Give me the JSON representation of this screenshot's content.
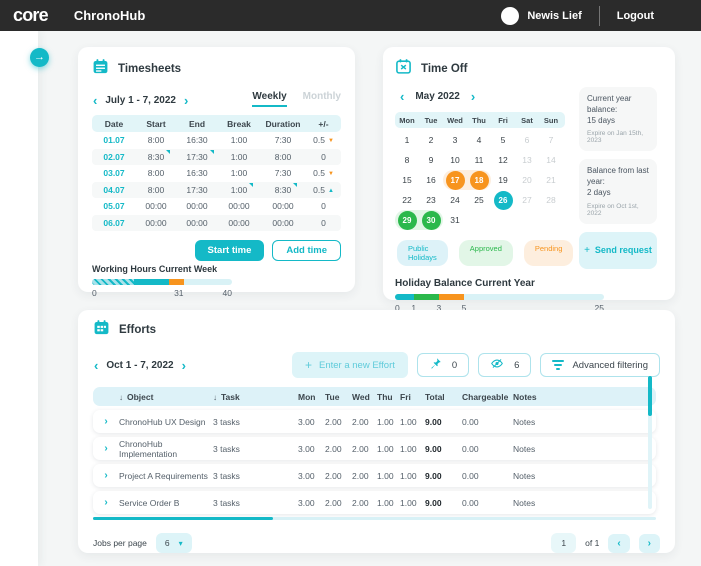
{
  "colors": {
    "accent": "#14b9c7",
    "accent_light_bg": "#ddf4f8",
    "table_header_bg": "#e2f5f8",
    "orange": "#f7941e",
    "orange_light_bg": "#fdeede",
    "green": "#2bb84c",
    "green_light_bg": "#e2f6e7",
    "topbar_bg": "#2b2b2b",
    "muted_text": "#c8cdd0"
  },
  "icons": [
    "arrow-right-icon",
    "home-icon",
    "calendar-icon",
    "wrench-icon",
    "check-circle-icon",
    "trend-icon",
    "chevron-left-icon",
    "chevron-right-icon",
    "chevron-down-icon",
    "timesheets-calendar-icon",
    "timeoff-calendar-icon",
    "efforts-calendar-icon",
    "plus-icon",
    "pin-icon",
    "eye-off-icon",
    "filter-icon",
    "sort-down-icon",
    "triangle-down-icon",
    "triangle-up-icon",
    "edited-flag-icon"
  ],
  "topbar": {
    "logo": "core",
    "app_title": "ChronoHub",
    "user_name": "Newis Lief",
    "logout_label": "Logout"
  },
  "sidebar": {
    "items": [
      "home",
      "timesheets",
      "tools",
      "approvals",
      "reports"
    ]
  },
  "timesheets": {
    "title": "Timesheets",
    "date_range": "July 1 - 7, 2022",
    "tabs": {
      "weekly": "Weekly",
      "monthly": "Monthly",
      "active": "Weekly"
    },
    "columns": [
      "Date",
      "Start",
      "End",
      "Break",
      "Duration",
      "+/-"
    ],
    "rows": [
      {
        "date": "01.07",
        "start": "8:00",
        "end": "16:30",
        "brk": "1:00",
        "duration": "7:30",
        "delta": "0.5",
        "trend": "down",
        "flags": []
      },
      {
        "date": "02.07",
        "start": "8:30",
        "end": "17:30",
        "brk": "1:00",
        "duration": "8:00",
        "delta": "0",
        "trend": "",
        "flags": [
          "start",
          "end"
        ]
      },
      {
        "date": "03.07",
        "start": "8:00",
        "end": "16:30",
        "brk": "1:00",
        "duration": "7:30",
        "delta": "0.5",
        "trend": "down",
        "flags": []
      },
      {
        "date": "04.07",
        "start": "8:00",
        "end": "17:30",
        "brk": "1:00",
        "duration": "8:30",
        "delta": "0.5",
        "trend": "up",
        "flags": [
          "brk",
          "duration"
        ]
      },
      {
        "date": "05.07",
        "start": "00:00",
        "end": "00:00",
        "brk": "00:00",
        "duration": "00:00",
        "delta": "0",
        "trend": "",
        "flags": []
      },
      {
        "date": "06.07",
        "start": "00:00",
        "end": "00:00",
        "brk": "00:00",
        "duration": "00:00",
        "delta": "0",
        "trend": "",
        "flags": []
      }
    ],
    "start_button": "Start time",
    "add_button": "Add time",
    "working_hours": {
      "label": "Working Hours Current Week",
      "segments": [
        {
          "kind": "hatched",
          "pct": 30
        },
        {
          "kind": "teal",
          "pct": 25
        },
        {
          "kind": "orange",
          "pct": 11
        }
      ],
      "ticks": [
        {
          "label": "0",
          "pct": 0
        },
        {
          "label": "31",
          "pct": 62
        },
        {
          "label": "40",
          "pct": 100
        }
      ]
    }
  },
  "timeoff": {
    "title": "Time Off",
    "month": "May 2022",
    "weekdays": [
      "Mon",
      "Tue",
      "Wed",
      "Thu",
      "Fri",
      "Sat",
      "Sun"
    ],
    "days": [
      {
        "d": "1"
      },
      {
        "d": "2"
      },
      {
        "d": "3"
      },
      {
        "d": "4"
      },
      {
        "d": "5"
      },
      {
        "d": "6",
        "state": "muted"
      },
      {
        "d": "7",
        "state": "muted"
      },
      {
        "d": "8"
      },
      {
        "d": "9"
      },
      {
        "d": "10"
      },
      {
        "d": "11"
      },
      {
        "d": "12"
      },
      {
        "d": "13",
        "state": "muted"
      },
      {
        "d": "14",
        "state": "muted"
      },
      {
        "d": "15"
      },
      {
        "d": "16"
      },
      {
        "d": "17",
        "state": "pending",
        "pill": "start"
      },
      {
        "d": "18",
        "state": "pending",
        "pill": "end"
      },
      {
        "d": "19"
      },
      {
        "d": "20",
        "state": "muted"
      },
      {
        "d": "21",
        "state": "muted"
      },
      {
        "d": "22"
      },
      {
        "d": "23"
      },
      {
        "d": "24"
      },
      {
        "d": "25"
      },
      {
        "d": "26",
        "state": "holiday"
      },
      {
        "d": "27",
        "state": "muted"
      },
      {
        "d": "28",
        "state": "muted"
      },
      {
        "d": "29",
        "state": "approved",
        "pill": "start"
      },
      {
        "d": "30",
        "state": "approved",
        "pill": "end"
      },
      {
        "d": "31"
      }
    ],
    "balances": [
      {
        "title": "Current year balance:",
        "value": "15 days",
        "note": "Expire on Jan 15th, 2023"
      },
      {
        "title": "Balance from last year:",
        "value": "2 days",
        "note": "Expire on Oct 1st, 2022"
      }
    ],
    "send_request": "Send request",
    "legend": [
      {
        "label": "Public Holidays",
        "type": "holiday"
      },
      {
        "label": "Approved",
        "type": "approved"
      },
      {
        "label": "Pending",
        "type": "pending"
      }
    ],
    "balance_bar": {
      "title": "Holiday Balance Current Year",
      "segments": [
        {
          "kind": "teal",
          "pct": 9
        },
        {
          "kind": "green",
          "pct": 12
        },
        {
          "kind": "orange",
          "pct": 12
        }
      ],
      "ticks": [
        {
          "label": "0",
          "pct": 0
        },
        {
          "label": "1",
          "pct": 9
        },
        {
          "label": "3",
          "pct": 21
        },
        {
          "label": "5",
          "pct": 33
        },
        {
          "label": "25",
          "pct": 100
        }
      ]
    }
  },
  "efforts": {
    "title": "Efforts",
    "date_range": "Oct 1 - 7, 2022",
    "new_effort_button": "Enter a new Effort",
    "pinned_count": "0",
    "hidden_count": "6",
    "filter_button": "Advanced filtering",
    "columns": {
      "object": "Object",
      "task": "Task",
      "days": [
        "Mon",
        "Tue",
        "Wed",
        "Thu",
        "Fri"
      ],
      "total": "Total",
      "chargeable": "Chargeable",
      "notes": "Notes"
    },
    "rows": [
      {
        "object": "ChronoHub UX Design",
        "task": "3 tasks",
        "days": [
          "3.00",
          "2.00",
          "2.00",
          "1.00",
          "1.00"
        ],
        "total": "9.00",
        "chargeable": "0.00",
        "notes": "Notes"
      },
      {
        "object": "ChronoHub Implementation",
        "task": "3 tasks",
        "days": [
          "3.00",
          "2.00",
          "2.00",
          "1.00",
          "1.00"
        ],
        "total": "9.00",
        "chargeable": "0.00",
        "notes": "Notes"
      },
      {
        "object": "Project A Requirements",
        "task": "3 tasks",
        "days": [
          "3.00",
          "2.00",
          "2.00",
          "1.00",
          "1.00"
        ],
        "total": "9.00",
        "chargeable": "0.00",
        "notes": "Notes"
      },
      {
        "object": "Service Order B",
        "task": "3 tasks",
        "days": [
          "3.00",
          "2.00",
          "2.00",
          "1.00",
          "1.00"
        ],
        "total": "9.00",
        "chargeable": "0.00",
        "notes": "Notes"
      }
    ],
    "pagination": {
      "jobs_per_page_label": "Jobs per page",
      "per_page_value": "6",
      "page": "1",
      "of_label": "of 1"
    }
  }
}
